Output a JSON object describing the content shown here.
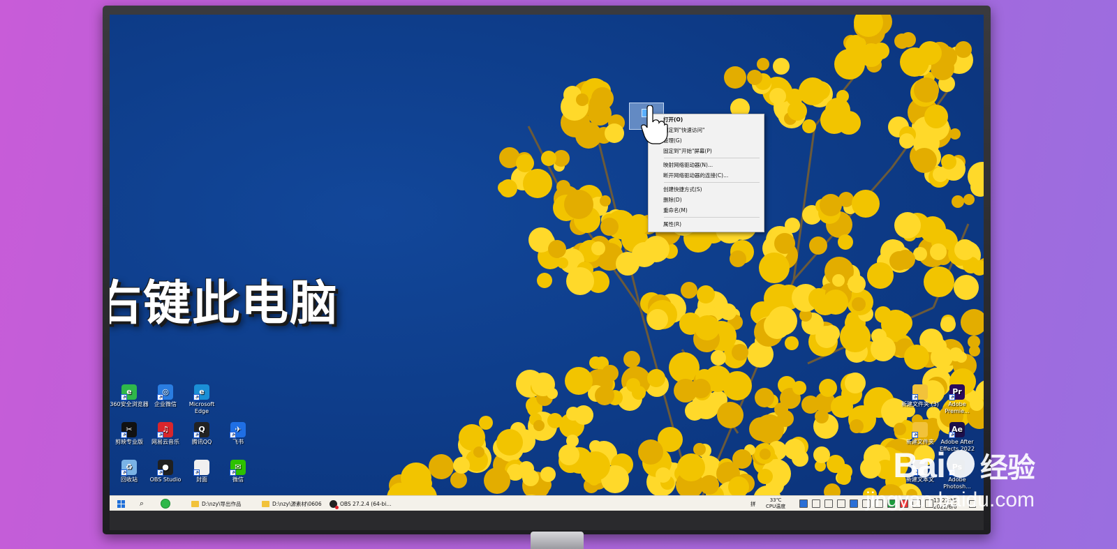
{
  "overlay": {
    "title": "右键此电脑"
  },
  "context_menu": {
    "items": [
      {
        "label": "打开(O)",
        "bold": true
      },
      {
        "label": "固定到\"快速访问\""
      },
      {
        "label": "管理(G)"
      },
      {
        "label": "固定到\"开始\"屏幕(P)"
      },
      {
        "sep": true
      },
      {
        "label": "映射网络驱动器(N)..."
      },
      {
        "label": "断开网络驱动器的连接(C)..."
      },
      {
        "sep": true
      },
      {
        "label": "创建快捷方式(S)"
      },
      {
        "label": "删除(D)"
      },
      {
        "label": "重命名(M)"
      },
      {
        "sep": true
      },
      {
        "label": "属性(R)"
      }
    ]
  },
  "desktop_icons": {
    "left": [
      {
        "label": "360安全浏览器",
        "icon": "browser-360-icon",
        "color": "#2fb84a",
        "glyph": "e"
      },
      {
        "label": "企业微信",
        "icon": "wecom-icon",
        "color": "#2a7de1",
        "glyph": "◎"
      },
      {
        "label": "Microsoft Edge",
        "icon": "edge-icon",
        "color": "#1b8fd6",
        "glyph": "e"
      },
      {
        "label": "剪映专业版",
        "icon": "capcut-icon",
        "color": "#111111",
        "glyph": "✂"
      },
      {
        "label": "网易云音乐",
        "icon": "netease-music-icon",
        "color": "#d8262c",
        "glyph": "♫"
      },
      {
        "label": "腾讯QQ",
        "icon": "qq-icon",
        "color": "#222222",
        "glyph": "Q"
      },
      {
        "label": "飞书",
        "icon": "feishu-icon",
        "color": "#1f6fe5",
        "glyph": "✈"
      },
      {
        "label": "回收站",
        "icon": "recycle-bin-icon",
        "color": "#7ab3e6",
        "glyph": "♻"
      },
      {
        "label": "OBS Studio",
        "icon": "obs-icon",
        "color": "#202020",
        "glyph": "●"
      },
      {
        "label": "封面",
        "icon": "file-icon",
        "color": "#f0f0f0",
        "glyph": ""
      },
      {
        "label": "微信",
        "icon": "wechat-icon",
        "color": "#2dc100",
        "glyph": "✉"
      }
    ],
    "right": [
      {
        "label": "新建文件夹 (3)",
        "icon": "folder-icon",
        "color": "#f2c23a",
        "glyph": ""
      },
      {
        "label": "Adobe Premie...",
        "icon": "premiere-icon",
        "color": "#2a0a5e",
        "glyph": "Pr"
      },
      {
        "label": "新建文件夹",
        "icon": "folder-icon",
        "color": "#f2c23a",
        "glyph": ""
      },
      {
        "label": "Adobe After Effects 2022",
        "icon": "after-effects-icon",
        "color": "#1c0f4a",
        "glyph": "Ae"
      },
      {
        "label": "新建文本文",
        "icon": "file-icon",
        "color": "#f0f0f0",
        "glyph": ""
      },
      {
        "label": "Adobe Photosh...",
        "icon": "photoshop-icon",
        "color": "#0a2a4a",
        "glyph": "Ps"
      }
    ]
  },
  "taskbar": {
    "tasks": [
      {
        "label": "D:\\nzy\\导出作品",
        "icon": "folder-icon"
      },
      {
        "label": "D:\\nzy\\源素材\\0606",
        "icon": "folder-icon"
      },
      {
        "label": "OBS 27.2.4 (64-bi...",
        "icon": "obs-icon"
      }
    ],
    "temp": "33℃",
    "temp_label": "CPU温度",
    "tray_glyph": "拼",
    "time": "13:27:55",
    "date": "2022/6/6"
  },
  "watermark": {
    "brand": "Bai",
    "brand_cn": "经验",
    "url": "jingyan.baidu.com"
  }
}
